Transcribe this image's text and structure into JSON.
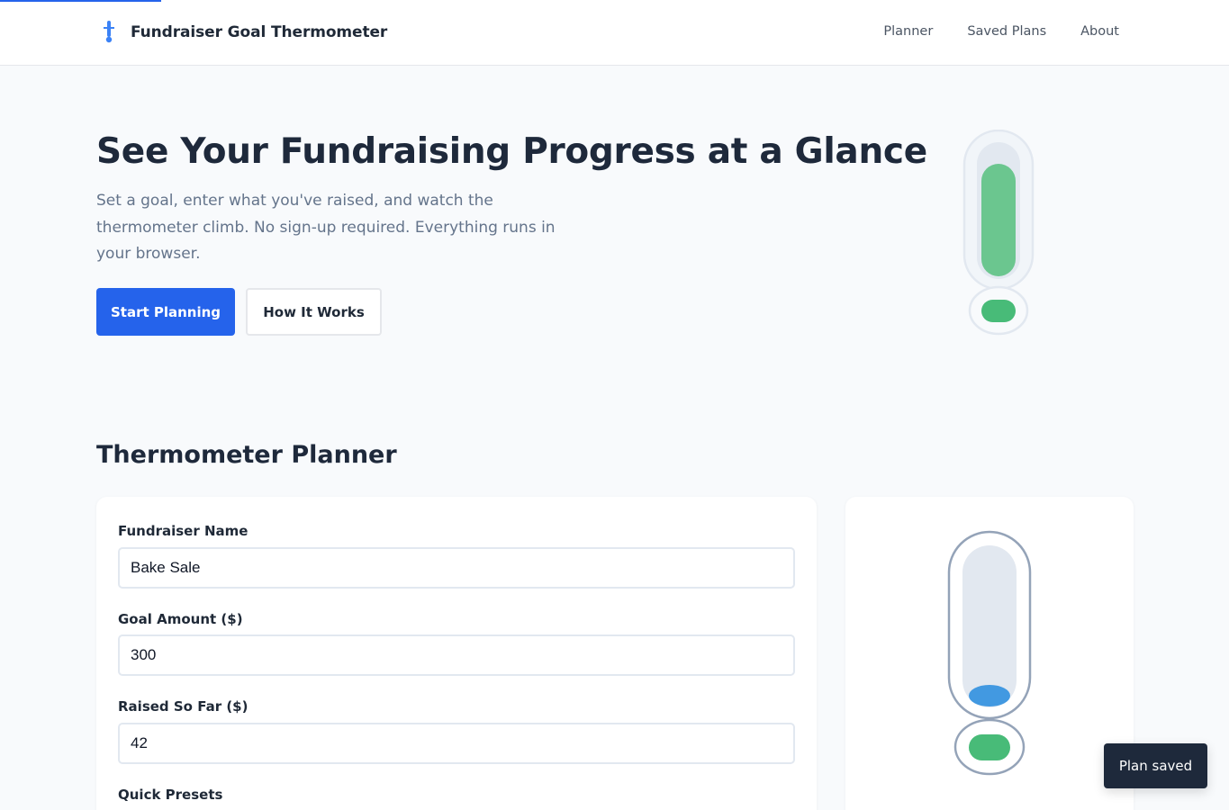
{
  "header": {
    "brand_title": "Fundraiser Goal Thermometer",
    "brand_icon": "thermometer-icon",
    "nav": [
      "Planner",
      "Saved Plans",
      "About"
    ]
  },
  "hero": {
    "title": "See Your Fundraising Progress at a Glance",
    "subtitle": "Set a goal, enter what you've raised, and watch the thermometer climb. No sign-up required. Everything runs in your browser.",
    "primary_button": "Start Planning",
    "secondary_button": "How It Works"
  },
  "planner": {
    "title": "Thermometer Planner",
    "fields": {
      "name_label": "Fundraiser Name",
      "name_value": "Bake Sale",
      "goal_label": "Goal Amount ($)",
      "goal_value": "300",
      "raised_label": "Raised So Far ($)",
      "raised_value": "42",
      "presets_label": "Quick Presets"
    }
  },
  "toast": {
    "text": "Plan saved"
  },
  "colors": {
    "accent": "#2563eb",
    "fill_green": "#48bb78",
    "fill_blue": "#4299e1",
    "dark": "#1e293b"
  }
}
